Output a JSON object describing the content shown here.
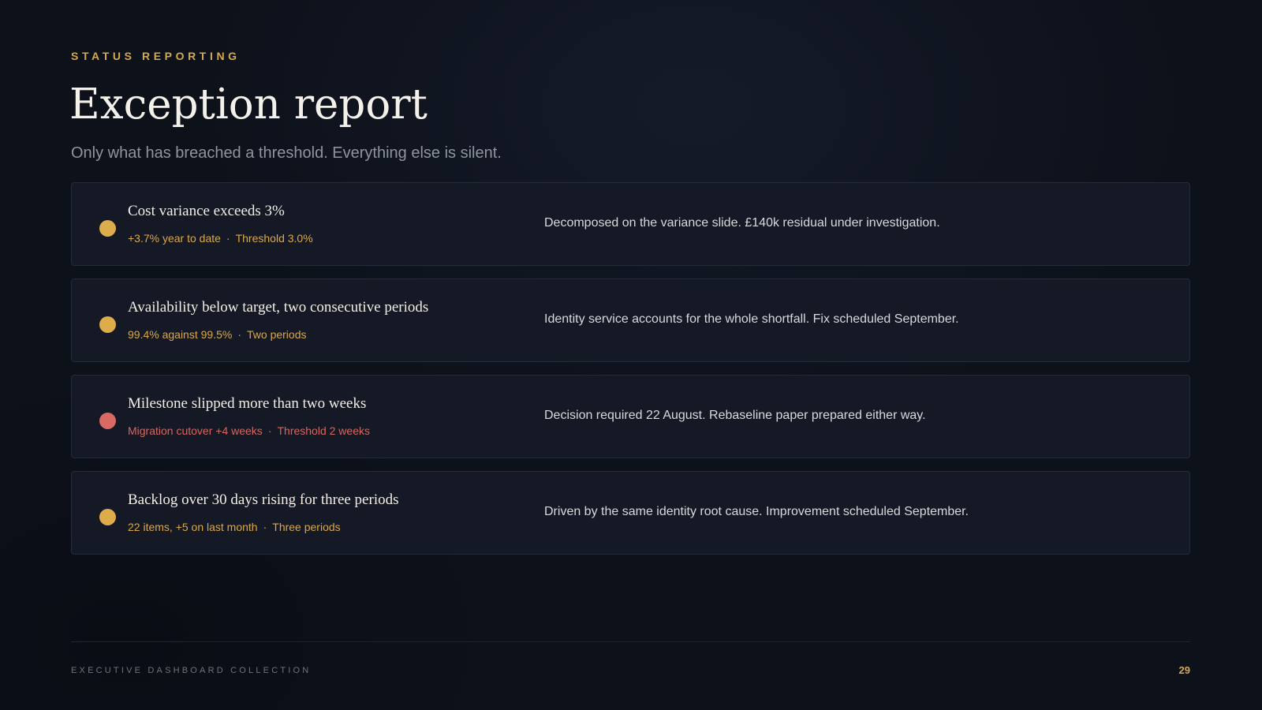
{
  "header": {
    "eyebrow": "STATUS REPORTING",
    "title": "Exception report",
    "subtitle": "Only what has breached a threshold. Everything else is silent."
  },
  "exceptions": [
    {
      "severity": "amber",
      "color": "#ddad4c",
      "title": "Cost variance exceeds 3%",
      "metric": "+3.7% year to date",
      "threshold": "Threshold 3.0%",
      "note": "Decomposed on the variance slide. £140k residual under investigation."
    },
    {
      "severity": "amber",
      "color": "#ddad4c",
      "title": "Availability below target, two consecutive periods",
      "metric": "99.4% against 99.5%",
      "threshold": "Two periods",
      "note": "Identity service accounts for the whole shortfall. Fix scheduled September."
    },
    {
      "severity": "red",
      "color": "#d96a63",
      "title": "Milestone slipped more than two weeks",
      "metric": "Migration cutover +4 weeks",
      "threshold": "Threshold 2 weeks",
      "note": "Decision required 22 August. Rebaseline paper prepared either way."
    },
    {
      "severity": "amber",
      "color": "#ddad4c",
      "title": "Backlog over 30 days rising for three periods",
      "metric": "22 items, +5 on last month",
      "threshold": "Three periods",
      "note": "Driven by the same identity root cause. Improvement scheduled September."
    }
  ],
  "separator": "·",
  "footer": {
    "label": "EXECUTIVE DASHBOARD COLLECTION",
    "page_number": "29"
  }
}
